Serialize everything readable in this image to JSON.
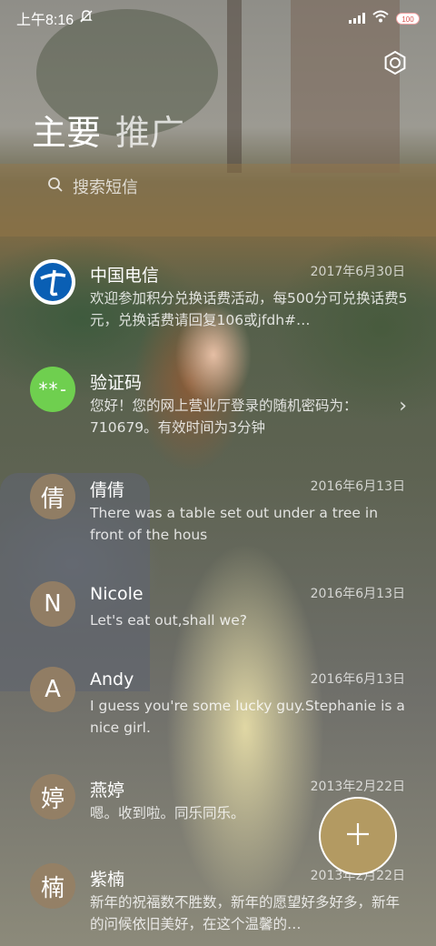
{
  "status_bar": {
    "time": "上午8:16",
    "battery": "100"
  },
  "tabs": [
    {
      "label": "主要"
    },
    {
      "label": "推广"
    }
  ],
  "search": {
    "placeholder": "搜索短信"
  },
  "conversations": [
    {
      "name": "中国电信",
      "date": "2017年6月30日",
      "preview": "欢迎参加积分兑换话费活动，每500分可兑换话费5元，兑换话费请回复106或jfdh#…",
      "avatar_type": "telecom-logo"
    },
    {
      "name": "验证码",
      "date": "",
      "preview": "您好！您的网上营业厅登录的随机密码为：710679。有效时间为3分钟",
      "avatar_text": "**-",
      "avatar_type": "code"
    },
    {
      "name": "倩倩",
      "date": "2016年6月13日",
      "preview": "There was a table set out under a tree in front of the hous",
      "avatar_text": "倩",
      "avatar_type": "letter"
    },
    {
      "name": "Nicole",
      "date": "2016年6月13日",
      "preview": "Let's eat out,shall we?",
      "avatar_text": "N",
      "avatar_type": "letter"
    },
    {
      "name": "Andy",
      "date": "2016年6月13日",
      "preview": "I guess you're some lucky guy.Stephanie is a nice girl.",
      "avatar_text": "A",
      "avatar_type": "letter"
    },
    {
      "name": "燕婷",
      "date": "2013年2月22日",
      "preview": "嗯。收到啦。同乐同乐。",
      "avatar_text": "婷",
      "avatar_type": "letter"
    },
    {
      "name": "紫楠",
      "date": "2013年2月22日",
      "preview": "新年的祝福数不胜数，新年的愿望好多好多，新年的问候依旧美好，在这个温馨的…",
      "avatar_text": "楠",
      "avatar_type": "letter"
    }
  ],
  "colors": {
    "fab": "#b39a62",
    "avatar": "#96805f",
    "code_avatar": "#6fcf4f",
    "telecom_blue": "#0a5fb4"
  },
  "icons": {
    "settings": "gear-icon",
    "search": "search-icon",
    "compose": "plus-icon",
    "chevron": "chevron-right-icon"
  }
}
